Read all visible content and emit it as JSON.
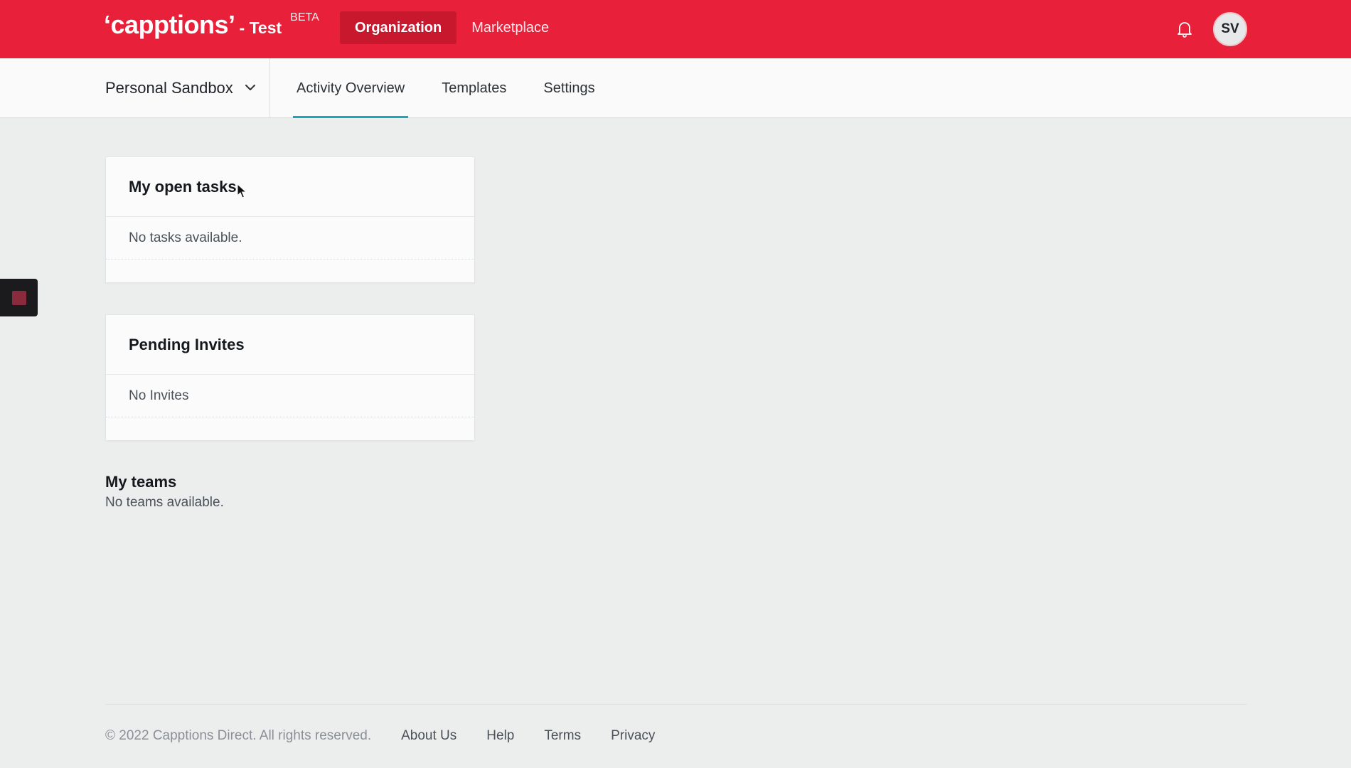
{
  "header": {
    "brand": "‘capptions’",
    "env": "- Test",
    "beta": "BETA",
    "nav": [
      {
        "label": "Organization",
        "active": true
      },
      {
        "label": "Marketplace",
        "active": false
      }
    ],
    "bell_icon": "bell-icon",
    "avatar_initials": "SV",
    "color": "#e8203a"
  },
  "subnav": {
    "workspace": "Personal Sandbox",
    "tabs": [
      {
        "label": "Activity Overview",
        "active": true
      },
      {
        "label": "Templates",
        "active": false
      },
      {
        "label": "Settings",
        "active": false
      }
    ],
    "active_color": "#17a9b8"
  },
  "open_tasks": {
    "title": "My open tasks",
    "empty": "No tasks available."
  },
  "invites": {
    "title": "Pending Invites",
    "empty": "No Invites"
  },
  "teams": {
    "title": "My teams",
    "empty": "No teams available."
  },
  "footer": {
    "copyright": "© 2022 Capptions Direct. All rights reserved.",
    "links": [
      "About Us",
      "Help",
      "Terms",
      "Privacy"
    ]
  }
}
